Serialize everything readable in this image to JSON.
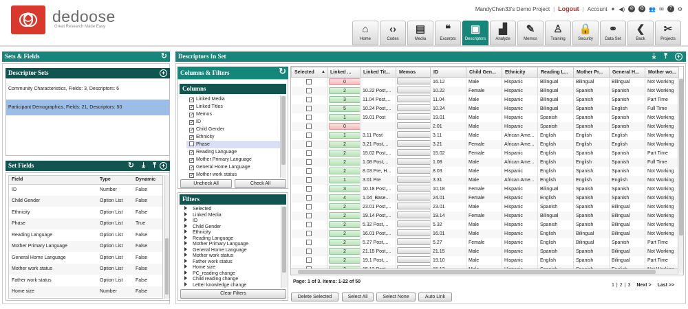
{
  "brand": {
    "name": "dedoose",
    "tagline": "Great Research Made Easy"
  },
  "topbar": {
    "project": "MandyChen33's Demo Project",
    "logout": "Logout",
    "account": "Account"
  },
  "nav": [
    {
      "label": "Home",
      "icon": "home-icon",
      "glyph": "⌂",
      "active": false
    },
    {
      "label": "Codes",
      "icon": "codes-icon",
      "glyph": "‹›",
      "active": false
    },
    {
      "label": "Media",
      "icon": "media-icon",
      "glyph": "▤",
      "active": false
    },
    {
      "label": "Excerpts",
      "icon": "quote-icon",
      "glyph": "❝",
      "active": false
    },
    {
      "label": "Descriptors",
      "icon": "clipboard-icon",
      "glyph": "▣",
      "active": true
    },
    {
      "label": "Analyze",
      "icon": "bar-chart-icon",
      "glyph": "▟",
      "active": false
    },
    {
      "label": "Memos",
      "icon": "memo-icon",
      "glyph": "✎",
      "active": false
    },
    {
      "label": "Training",
      "icon": "person-icon",
      "glyph": "♙",
      "active": false
    },
    {
      "label": "Security",
      "icon": "lock-icon",
      "glyph": "🔒",
      "active": false
    },
    {
      "label": "Data Set",
      "icon": "binoculars-icon",
      "glyph": "⚭",
      "active": false
    },
    {
      "label": "Back",
      "icon": "back-icon",
      "glyph": "❮",
      "active": false
    },
    {
      "label": "Projects",
      "icon": "projects-icon",
      "glyph": "✂",
      "active": false
    }
  ],
  "sets_fields": {
    "title": "Sets & Fields",
    "descriptor_sets": {
      "title": "Descriptor Sets",
      "items": [
        {
          "label": "Community Characteristics, Fields: 3, Descriptors: 6",
          "selected": false
        },
        {
          "label": "Participant Demographics, Fields: 21, Descriptors: 50",
          "selected": true
        }
      ]
    },
    "set_fields": {
      "title": "Set Fields",
      "columns": [
        "Field",
        "Type",
        "Dynamic"
      ],
      "rows": [
        [
          "ID",
          "Number",
          "False"
        ],
        [
          "Child Gender",
          "Option List",
          "False"
        ],
        [
          "Ethnicity",
          "Option List",
          "False"
        ],
        [
          "Phase",
          "Option List",
          "True"
        ],
        [
          "Reading Language",
          "Option List",
          "False"
        ],
        [
          "Mother Primary Language",
          "Option List",
          "False"
        ],
        [
          "General Home Language",
          "Option List",
          "False"
        ],
        [
          "Mother work status",
          "Option List",
          "False"
        ],
        [
          "Father work status",
          "Option List",
          "False"
        ],
        [
          "Home size",
          "Number",
          "False"
        ]
      ]
    }
  },
  "descriptors_in_set": {
    "title": "Descriptors In Set",
    "columns_filters": {
      "title": "Columns & Filters",
      "columns_title": "Columns",
      "columns": [
        {
          "label": "Linked Media",
          "checked": true,
          "highlight": false
        },
        {
          "label": "Linked Titles",
          "checked": true,
          "highlight": false
        },
        {
          "label": "Memos",
          "checked": true,
          "highlight": false
        },
        {
          "label": "ID",
          "checked": true,
          "highlight": false
        },
        {
          "label": "Child Gender",
          "checked": true,
          "highlight": false
        },
        {
          "label": "Ethnicity",
          "checked": true,
          "highlight": false
        },
        {
          "label": "Phase",
          "checked": false,
          "highlight": true
        },
        {
          "label": "Reading Language",
          "checked": true,
          "highlight": false
        },
        {
          "label": "Mother Primary Language",
          "checked": true,
          "highlight": false
        },
        {
          "label": "General Home Language",
          "checked": true,
          "highlight": false
        },
        {
          "label": "Mother work status",
          "checked": true,
          "highlight": false
        }
      ],
      "uncheck_all": "Uncheck All",
      "check_all": "Check All",
      "filters_title": "Filters",
      "filters": [
        "Selected",
        "Linked Media",
        "ID",
        "Child Gender",
        "Ethnicity",
        "Reading Language",
        "Mother Primary Language",
        "General Home Language",
        "Mother work status",
        "Father work status",
        "Home size",
        "PC_reading change",
        "Child reading change",
        "Letter knowledge change"
      ],
      "clear_filters": "Clear Filters"
    },
    "grid": {
      "columns": [
        "Selected",
        "Linked ...",
        "Linked Tit...",
        "Memos",
        "ID",
        "Child Gen...",
        "Ethnicity",
        "Reading L...",
        "Mother Pr...",
        "General H...",
        "Mother wo..."
      ],
      "sort_indicator": "▲",
      "rows": [
        [
          "0",
          "",
          "16.12",
          "Male",
          "Hispanic",
          "Bilingual",
          "Bilingual",
          "Bilingual",
          "Not Working"
        ],
        [
          "2",
          "10.22 Post,...",
          "10.22",
          "Female",
          "Hispanic",
          "Bilingual",
          "Spanish",
          "Spanish",
          "Not Working"
        ],
        [
          "3",
          "11.04 Post,...",
          "11.04",
          "Male",
          "Hispanic",
          "Bilingual",
          "Spanish",
          "Spanish",
          "Part Time"
        ],
        [
          "5",
          "10.24 Post,...",
          "10.24",
          "Male",
          "Hispanic",
          "Bilingual",
          "Spanish",
          "English",
          "Full Time"
        ],
        [
          "1",
          "19.01 Post",
          "19.01",
          "Male",
          "Hispanic",
          "Spanish",
          "Spanish",
          "Spanish",
          "Not Working"
        ],
        [
          "0",
          "",
          "2.01",
          "Male",
          "Hispanic",
          "Spanish",
          "Spanish",
          "Spanish",
          "Not Working"
        ],
        [
          "1",
          "3.11 Post",
          "3.11",
          "Male",
          "African Ame...",
          "English",
          "English",
          "English",
          "Not Working"
        ],
        [
          "2",
          "3.21 Post,...",
          "3.21",
          "Female",
          "African Ame...",
          "English",
          "English",
          "English",
          "Not Working"
        ],
        [
          "2",
          "15.02 Post,...",
          "15.02",
          "Female",
          "Hispanic",
          "English",
          "Spanish",
          "Spanish",
          "Part Time"
        ],
        [
          "2",
          "1.08 Post,...",
          "1.08",
          "Male",
          "African Ame...",
          "English",
          "English",
          "Spanish",
          "Full Time"
        ],
        [
          "2",
          "8.03 Pre, H...",
          "8.03",
          "Male",
          "Hispanic",
          "English",
          "Spanish",
          "Spanish",
          "Not Working"
        ],
        [
          "1",
          "3.01 Pre",
          "3.31",
          "Male",
          "African Ame...",
          "English",
          "English",
          "English",
          "Not Working"
        ],
        [
          "3",
          "10.18 Post,...",
          "10.18",
          "Female",
          "Hispanic",
          "Bilingual",
          "Spanish",
          "Spanish",
          "Not Working"
        ],
        [
          "4",
          "1.04_Base...",
          "24.01",
          "Female",
          "Hispanic",
          "English",
          "Spanish",
          "Spanish",
          "Not Working"
        ],
        [
          "2",
          "23.01 Post,...",
          "23.01",
          "Male",
          "Hispanic",
          "Spanish",
          "Spanish",
          "Bilingual",
          "Not Working"
        ],
        [
          "2",
          "19.14 Post,...",
          "19.14",
          "Female",
          "Hispanic",
          "Bilingual",
          "Spanish",
          "Bilingual",
          "Not Working"
        ],
        [
          "2",
          "5.32 Post,...",
          "5.32",
          "Male",
          "Hispanic",
          "Spanish",
          "Spanish",
          "Bilingual",
          "Not Working"
        ],
        [
          "2",
          "16.01 Post,...",
          "16.01",
          "Male",
          "Hispanic",
          "English",
          "Bilingual",
          "Bilingual",
          "Not Working"
        ],
        [
          "2",
          "5.27 Post,...",
          "5.27",
          "Female",
          "Hispanic",
          "English",
          "Bilingual",
          "Spanish",
          "Part Time"
        ],
        [
          "2",
          "21.15 Post,...",
          "21.15",
          "Male",
          "Hispanic",
          "Spanish",
          "Spanish",
          "Bilingual",
          "Not Working"
        ],
        [
          "2",
          "19.1 Post,...",
          "19.10",
          "Male",
          "Hispanic",
          "English",
          "Spanish",
          "Bilingual",
          "Part Time"
        ],
        [
          "2",
          "15.13 Post",
          "15.13",
          "Male",
          "Hispanic",
          "Spanish",
          "Spanish",
          "English",
          "Not Working"
        ]
      ]
    },
    "page_info": "Page: 1 of 3. Items: 1-22 of 50",
    "pager": {
      "p1": "1",
      "p2": "2",
      "p3": "3",
      "next": "Next >",
      "last": "Last >>"
    },
    "buttons": {
      "delete": "Delete Selected",
      "select_all": "Select All",
      "select_none": "Select None",
      "auto_link": "Auto Link"
    }
  },
  "colors": {
    "teal": "#16867a",
    "dark_teal": "#10554f",
    "logo_red": "#d9382c",
    "selected_row": "#9bbde6",
    "pill_green": "#c8ecc8",
    "pill_red": "#f8caca"
  }
}
